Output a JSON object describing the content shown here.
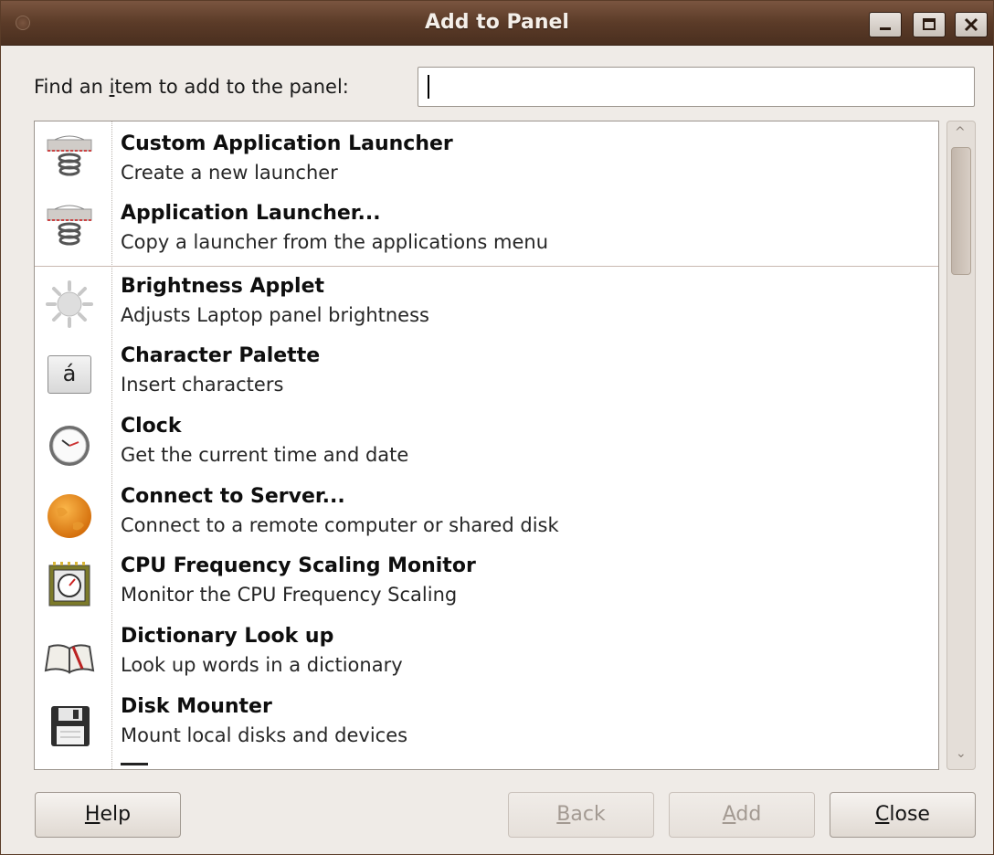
{
  "window": {
    "title": "Add to Panel"
  },
  "find": {
    "label_pre": "Find an ",
    "label_mnemonic": "i",
    "label_post": "tem to add to the panel:",
    "value": "",
    "placeholder": ""
  },
  "items": [
    {
      "name": "Custom Application Launcher",
      "desc": "Create a new launcher",
      "icon": "launcher-spring-icon"
    },
    {
      "name": "Application Launcher...",
      "desc": "Copy a launcher from the applications menu",
      "icon": "launcher-spring-icon"
    },
    {
      "name": "Brightness Applet",
      "desc": "Adjusts Laptop panel brightness",
      "icon": "brightness-sun-icon"
    },
    {
      "name": "Character Palette",
      "desc": "Insert characters",
      "icon": "character-palette-icon",
      "glyph": "á"
    },
    {
      "name": "Clock",
      "desc": "Get the current time and date",
      "icon": "clock-icon"
    },
    {
      "name": "Connect to Server...",
      "desc": "Connect to a remote computer or shared disk",
      "icon": "globe-icon"
    },
    {
      "name": "CPU Frequency Scaling Monitor",
      "desc": "Monitor the CPU Frequency Scaling",
      "icon": "cpu-gauge-icon"
    },
    {
      "name": "Dictionary Look up",
      "desc": "Look up words in a dictionary",
      "icon": "dictionary-book-icon"
    },
    {
      "name": "Disk Mounter",
      "desc": "Mount local disks and devices",
      "icon": "floppy-disk-icon"
    }
  ],
  "buttons": {
    "help": {
      "mnemonic": "H",
      "rest": "elp"
    },
    "back": {
      "mnemonic": "B",
      "rest": "ack"
    },
    "add": {
      "mnemonic": "A",
      "rest": "dd"
    },
    "close": {
      "mnemonic": "C",
      "rest": "lose"
    }
  },
  "colors": {
    "titlebar": "#5b3b28",
    "window_bg": "#efebe7",
    "separator": "#c8b8b0"
  }
}
